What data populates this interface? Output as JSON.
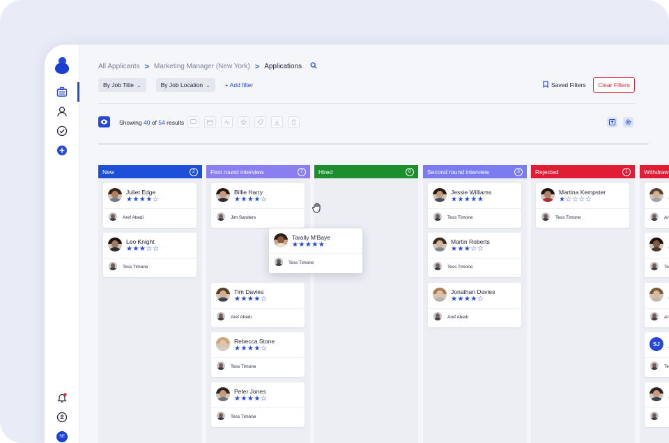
{
  "breadcrumb": {
    "items": [
      "All Applicants",
      "Marketing Manager (New York)",
      "Applications"
    ],
    "separator": ">"
  },
  "filters": {
    "job_title": "By Job Title",
    "job_location": "By Job Location",
    "add_filter": "+ Add filter"
  },
  "saved_filters": "Saved Filters",
  "clear_filters": "Clear Filters",
  "results": {
    "showing": "Showing",
    "shown": "40",
    "of": "of",
    "total": "54",
    "suffix": "results"
  },
  "avatar_initials": "SE",
  "colors": {
    "accent": "#2549d6",
    "new": "#1d4fd8",
    "first_round": "#8a7ff0",
    "hired": "#1c8f2c",
    "second_round": "#7b7cf1",
    "rejected": "#e11d35",
    "withdrawn": "#e11d35",
    "danger": "#e02a3c"
  },
  "columns": [
    {
      "title": "New",
      "count": "2",
      "cards": [
        {
          "name": "Juliet Edge",
          "stars": "★★★★☆",
          "sub": "Aref Abedi"
        },
        {
          "name": "Leo  Knight",
          "stars": "★★★☆☆",
          "sub": "Tess Timone"
        }
      ]
    },
    {
      "title": "First round interview",
      "count": "7",
      "cards": [
        {
          "name": "Billie Harry",
          "stars": "★★★★☆",
          "sub": "Jim Sanders"
        },
        {
          "name": "Tim Davies",
          "stars": "★★★★☆",
          "sub": "Aref Abedi"
        },
        {
          "name": "Rebecca Stone",
          "stars": "★★★★☆",
          "sub": "Tess Timone"
        },
        {
          "name": "Peter Jones",
          "stars": "★★★★☆",
          "sub": "Tess Timone"
        }
      ]
    },
    {
      "title": "Hired",
      "count": "0",
      "cards": []
    },
    {
      "title": "Second round interview",
      "count": "3",
      "cards": [
        {
          "name": "Jessie Williams",
          "stars": "★★★★★",
          "sub": "Tess Timone"
        },
        {
          "name": "Martin Roberts",
          "stars": "★★★☆☆",
          "sub": "Tess Timone"
        },
        {
          "name": "Jonathan Davies",
          "stars": "★★★★☆",
          "sub": "Aref Abedi"
        }
      ]
    },
    {
      "title": "Rejected",
      "count": "1",
      "cards": [
        {
          "name": "Martina Kempster",
          "stars": "★☆☆☆☆",
          "sub": "Tess Timone"
        }
      ]
    },
    {
      "title": "Withdrawn",
      "count": "",
      "cards": [
        {
          "name": "",
          "stars": "★",
          "sub": "An",
          "initials": ""
        },
        {
          "name": "",
          "stars": "★",
          "sub": "Te",
          "initials": ""
        },
        {
          "name": "",
          "stars": "★",
          "sub": "An",
          "initials": ""
        },
        {
          "name": "",
          "stars": "★",
          "sub": "Te",
          "initials": "SJ"
        },
        {
          "name": "",
          "stars": "★",
          "sub": "",
          "initials": ""
        }
      ]
    }
  ],
  "dragging_card": {
    "name": "Tarally M'Baye",
    "stars": "★★★★★",
    "sub": "Tess Timone"
  }
}
